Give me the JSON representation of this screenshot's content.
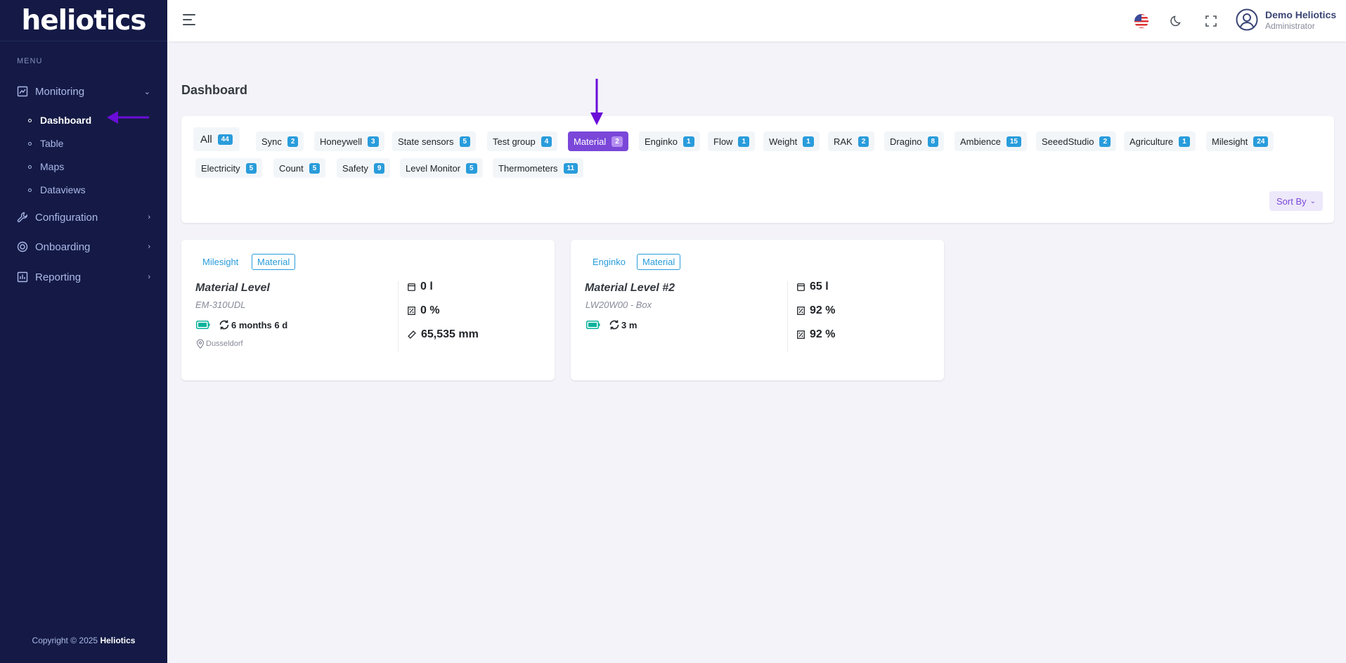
{
  "sidebar": {
    "logo": "heliotics",
    "menu_title": "MENU",
    "monitoring": "Monitoring",
    "sub_items": [
      "Dashboard",
      "Table",
      "Maps",
      "Dataviews"
    ],
    "configuration": "Configuration",
    "onboarding": "Onboarding",
    "reporting": "Reporting",
    "copyright_prefix": "Copyright © 2025",
    "copyright_brand": "Heliotics"
  },
  "topbar": {
    "user_name": "Demo Heliotics",
    "user_role": "Administrator"
  },
  "page": {
    "title": "Dashboard",
    "sort_label": "Sort By"
  },
  "filters": [
    {
      "label": "All",
      "count": "44"
    },
    {
      "label": "Sync",
      "count": "2"
    },
    {
      "label": "Honeywell",
      "count": "3"
    },
    {
      "label": "State sensors",
      "count": "5"
    },
    {
      "label": "Test group",
      "count": "4"
    },
    {
      "label": "Material",
      "count": "2"
    },
    {
      "label": "Enginko",
      "count": "1"
    },
    {
      "label": "Flow",
      "count": "1"
    },
    {
      "label": "Weight",
      "count": "1"
    },
    {
      "label": "RAK",
      "count": "2"
    },
    {
      "label": "Dragino",
      "count": "8"
    },
    {
      "label": "Ambience",
      "count": "15"
    },
    {
      "label": "SeeedStudio",
      "count": "2"
    },
    {
      "label": "Agriculture",
      "count": "1"
    },
    {
      "label": "Milesight",
      "count": "24"
    },
    {
      "label": "Electricity",
      "count": "5"
    },
    {
      "label": "Count",
      "count": "5"
    },
    {
      "label": "Safety",
      "count": "9"
    },
    {
      "label": "Level Monitor",
      "count": "5"
    },
    {
      "label": "Thermometers",
      "count": "11"
    }
  ],
  "devices": [
    {
      "brand": "Milesight",
      "group": "Material",
      "name": "Material Level",
      "model": "EM-310UDL",
      "last_seen": "6 months 6 d",
      "location": "Dusseldorf",
      "metrics": [
        "0 l",
        "0 %",
        "65,535 mm"
      ]
    },
    {
      "brand": "Enginko",
      "group": "Material",
      "name": "Material Level #2",
      "model": " LW20W00 - Box",
      "last_seen": "3 m",
      "metrics": [
        "65 l",
        "92 %",
        "92 %"
      ]
    }
  ],
  "colors": {
    "accent": "#7a47d9",
    "badge": "#299cdb",
    "sidebar": "#141a45",
    "battery": "#0ab39c"
  }
}
